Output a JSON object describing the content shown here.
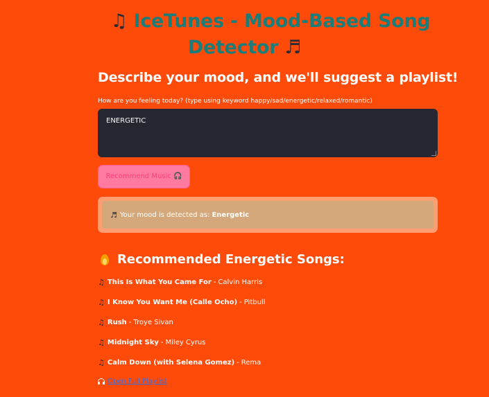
{
  "title": {
    "line1_emoji": "♫",
    "line1_text": "IceTunes - Mood-Based Song",
    "line2_text": "Detector",
    "line2_emoji": "♬"
  },
  "subheader": "Describe your mood, and we'll suggest a playlist!",
  "mood_input": {
    "label": "How are you feeling today? (type using keyword happy/sad/energetic/relaxed/romantic)",
    "value": "ENERGETIC"
  },
  "recommend_button": {
    "label": "Recommend Music",
    "icon": "headphones-icon"
  },
  "mood_alert": {
    "icon": "♬",
    "prefix": "Your mood is detected as:",
    "mood": "Energetic"
  },
  "recommendations": {
    "icon": "fire-icon",
    "heading": "Recommended Energetic Songs:",
    "songs": [
      {
        "title": "This Is What You Came For",
        "separator": "-",
        "artist": "Calvin Harris"
      },
      {
        "title": "I Know You Want Me (Calle Ocho)",
        "separator": "-",
        "artist": "Pitbull"
      },
      {
        "title": "Rush",
        "separator": "-",
        "artist": "Troye Sivan"
      },
      {
        "title": "Midnight Sky",
        "separator": "-",
        "artist": "Miley Cyrus"
      },
      {
        "title": "Calm Down (with Selena Gomez)",
        "separator": "-",
        "artist": "Rema"
      }
    ],
    "note_icon": "♫"
  },
  "playlist_link": {
    "icon": "headphones-icon",
    "label": "Open Full Playlist"
  },
  "colors": {
    "background": "#ff4b0a",
    "title": "#1c7d78",
    "textarea_bg": "#262730",
    "button_bg": "#ff7aa0",
    "alert_bg": "#d4a87a",
    "link": "#3b6cd8"
  }
}
